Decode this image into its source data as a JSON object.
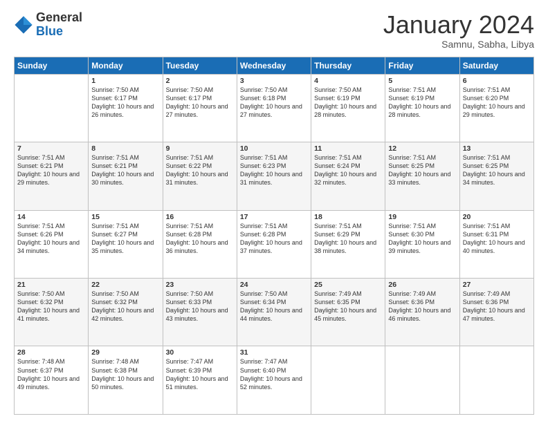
{
  "logo": {
    "general": "General",
    "blue": "Blue"
  },
  "header": {
    "month_title": "January 2024",
    "subtitle": "Samnu, Sabha, Libya"
  },
  "days_of_week": [
    "Sunday",
    "Monday",
    "Tuesday",
    "Wednesday",
    "Thursday",
    "Friday",
    "Saturday"
  ],
  "weeks": [
    [
      {
        "day": "",
        "sunrise": "",
        "sunset": "",
        "daylight": ""
      },
      {
        "day": "1",
        "sunrise": "Sunrise: 7:50 AM",
        "sunset": "Sunset: 6:17 PM",
        "daylight": "Daylight: 10 hours and 26 minutes."
      },
      {
        "day": "2",
        "sunrise": "Sunrise: 7:50 AM",
        "sunset": "Sunset: 6:17 PM",
        "daylight": "Daylight: 10 hours and 27 minutes."
      },
      {
        "day": "3",
        "sunrise": "Sunrise: 7:50 AM",
        "sunset": "Sunset: 6:18 PM",
        "daylight": "Daylight: 10 hours and 27 minutes."
      },
      {
        "day": "4",
        "sunrise": "Sunrise: 7:50 AM",
        "sunset": "Sunset: 6:19 PM",
        "daylight": "Daylight: 10 hours and 28 minutes."
      },
      {
        "day": "5",
        "sunrise": "Sunrise: 7:51 AM",
        "sunset": "Sunset: 6:19 PM",
        "daylight": "Daylight: 10 hours and 28 minutes."
      },
      {
        "day": "6",
        "sunrise": "Sunrise: 7:51 AM",
        "sunset": "Sunset: 6:20 PM",
        "daylight": "Daylight: 10 hours and 29 minutes."
      }
    ],
    [
      {
        "day": "7",
        "sunrise": "Sunrise: 7:51 AM",
        "sunset": "Sunset: 6:21 PM",
        "daylight": "Daylight: 10 hours and 29 minutes."
      },
      {
        "day": "8",
        "sunrise": "Sunrise: 7:51 AM",
        "sunset": "Sunset: 6:21 PM",
        "daylight": "Daylight: 10 hours and 30 minutes."
      },
      {
        "day": "9",
        "sunrise": "Sunrise: 7:51 AM",
        "sunset": "Sunset: 6:22 PM",
        "daylight": "Daylight: 10 hours and 31 minutes."
      },
      {
        "day": "10",
        "sunrise": "Sunrise: 7:51 AM",
        "sunset": "Sunset: 6:23 PM",
        "daylight": "Daylight: 10 hours and 31 minutes."
      },
      {
        "day": "11",
        "sunrise": "Sunrise: 7:51 AM",
        "sunset": "Sunset: 6:24 PM",
        "daylight": "Daylight: 10 hours and 32 minutes."
      },
      {
        "day": "12",
        "sunrise": "Sunrise: 7:51 AM",
        "sunset": "Sunset: 6:25 PM",
        "daylight": "Daylight: 10 hours and 33 minutes."
      },
      {
        "day": "13",
        "sunrise": "Sunrise: 7:51 AM",
        "sunset": "Sunset: 6:25 PM",
        "daylight": "Daylight: 10 hours and 34 minutes."
      }
    ],
    [
      {
        "day": "14",
        "sunrise": "Sunrise: 7:51 AM",
        "sunset": "Sunset: 6:26 PM",
        "daylight": "Daylight: 10 hours and 34 minutes."
      },
      {
        "day": "15",
        "sunrise": "Sunrise: 7:51 AM",
        "sunset": "Sunset: 6:27 PM",
        "daylight": "Daylight: 10 hours and 35 minutes."
      },
      {
        "day": "16",
        "sunrise": "Sunrise: 7:51 AM",
        "sunset": "Sunset: 6:28 PM",
        "daylight": "Daylight: 10 hours and 36 minutes."
      },
      {
        "day": "17",
        "sunrise": "Sunrise: 7:51 AM",
        "sunset": "Sunset: 6:28 PM",
        "daylight": "Daylight: 10 hours and 37 minutes."
      },
      {
        "day": "18",
        "sunrise": "Sunrise: 7:51 AM",
        "sunset": "Sunset: 6:29 PM",
        "daylight": "Daylight: 10 hours and 38 minutes."
      },
      {
        "day": "19",
        "sunrise": "Sunrise: 7:51 AM",
        "sunset": "Sunset: 6:30 PM",
        "daylight": "Daylight: 10 hours and 39 minutes."
      },
      {
        "day": "20",
        "sunrise": "Sunrise: 7:51 AM",
        "sunset": "Sunset: 6:31 PM",
        "daylight": "Daylight: 10 hours and 40 minutes."
      }
    ],
    [
      {
        "day": "21",
        "sunrise": "Sunrise: 7:50 AM",
        "sunset": "Sunset: 6:32 PM",
        "daylight": "Daylight: 10 hours and 41 minutes."
      },
      {
        "day": "22",
        "sunrise": "Sunrise: 7:50 AM",
        "sunset": "Sunset: 6:32 PM",
        "daylight": "Daylight: 10 hours and 42 minutes."
      },
      {
        "day": "23",
        "sunrise": "Sunrise: 7:50 AM",
        "sunset": "Sunset: 6:33 PM",
        "daylight": "Daylight: 10 hours and 43 minutes."
      },
      {
        "day": "24",
        "sunrise": "Sunrise: 7:50 AM",
        "sunset": "Sunset: 6:34 PM",
        "daylight": "Daylight: 10 hours and 44 minutes."
      },
      {
        "day": "25",
        "sunrise": "Sunrise: 7:49 AM",
        "sunset": "Sunset: 6:35 PM",
        "daylight": "Daylight: 10 hours and 45 minutes."
      },
      {
        "day": "26",
        "sunrise": "Sunrise: 7:49 AM",
        "sunset": "Sunset: 6:36 PM",
        "daylight": "Daylight: 10 hours and 46 minutes."
      },
      {
        "day": "27",
        "sunrise": "Sunrise: 7:49 AM",
        "sunset": "Sunset: 6:36 PM",
        "daylight": "Daylight: 10 hours and 47 minutes."
      }
    ],
    [
      {
        "day": "28",
        "sunrise": "Sunrise: 7:48 AM",
        "sunset": "Sunset: 6:37 PM",
        "daylight": "Daylight: 10 hours and 49 minutes."
      },
      {
        "day": "29",
        "sunrise": "Sunrise: 7:48 AM",
        "sunset": "Sunset: 6:38 PM",
        "daylight": "Daylight: 10 hours and 50 minutes."
      },
      {
        "day": "30",
        "sunrise": "Sunrise: 7:47 AM",
        "sunset": "Sunset: 6:39 PM",
        "daylight": "Daylight: 10 hours and 51 minutes."
      },
      {
        "day": "31",
        "sunrise": "Sunrise: 7:47 AM",
        "sunset": "Sunset: 6:40 PM",
        "daylight": "Daylight: 10 hours and 52 minutes."
      },
      {
        "day": "",
        "sunrise": "",
        "sunset": "",
        "daylight": ""
      },
      {
        "day": "",
        "sunrise": "",
        "sunset": "",
        "daylight": ""
      },
      {
        "day": "",
        "sunrise": "",
        "sunset": "",
        "daylight": ""
      }
    ]
  ]
}
